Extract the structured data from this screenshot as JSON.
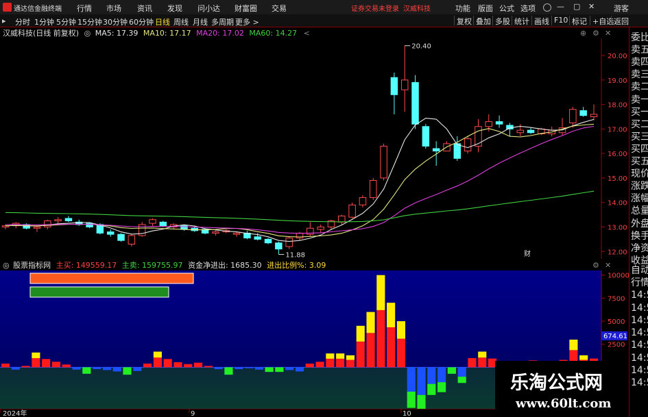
{
  "title_bar": {
    "app_name": "通达信金融终端",
    "menus": [
      "行情",
      "市场",
      "资讯",
      "发现",
      "问小达",
      "财富圈",
      "交易"
    ],
    "warning": "证券交易未登录",
    "stock_name": "汉威科技",
    "right_items": [
      "功能",
      "版面",
      "公式",
      "选项"
    ],
    "guest": "游客"
  },
  "toolbar": {
    "periods": [
      "分时",
      "1分钟",
      "5分钟",
      "15分钟",
      "30分钟",
      "60分钟",
      "日线",
      "周线",
      "月线",
      "多周期",
      "更多 >"
    ],
    "selected": "日线",
    "right_buttons": [
      "复权",
      "叠加",
      "多股",
      "统计",
      "画线",
      "F10",
      "标记",
      "+自选",
      "返回"
    ]
  },
  "main_chart": {
    "stock_label": "汉威科技(日线 前复权)",
    "ma": [
      {
        "label": "MA5: 17.39",
        "color": "#e6e6e6"
      },
      {
        "label": "MA10: 17.17",
        "color": "#e6e680"
      },
      {
        "label": "MA20: 17.02",
        "color": "#e040e0"
      },
      {
        "label": "MA60: 14.27",
        "color": "#40d040"
      }
    ],
    "y_ticks": [
      "20.00",
      "19.00",
      "18.00",
      "17.00",
      "16.00",
      "15.00",
      "14.00",
      "13.00",
      "12.00"
    ],
    "high_label": "20.40",
    "low_label": "11.88",
    "marker_text": "财"
  },
  "indicator": {
    "name": "股票指标网",
    "buy_label": "主买: 149559.17",
    "sell_label": "主卖: 159755.97",
    "net_label": "资金净进出: 1685.30",
    "ratio_label": "进出比例%: 3.09",
    "y_ticks": [
      "10000",
      "7500",
      "5000",
      "2500",
      "0",
      "-2500"
    ],
    "current_value": "674.61"
  },
  "x_axis": {
    "labels": [
      "2024年",
      "9",
      "10"
    ]
  },
  "right_panel": {
    "items": [
      "委比",
      "卖五",
      "卖四",
      "卖三",
      "卖二",
      "卖一",
      "买一",
      "买二",
      "买三",
      "买四",
      "买五",
      "现价",
      "涨跌",
      "涨幅",
      "总量",
      "外盘",
      "换手",
      "净资",
      "收益"
    ],
    "items2": [
      "自动",
      "行情",
      "14:50",
      "14:50",
      "14:50",
      "14:50",
      "14:50",
      "14:50",
      "14:50",
      "14:50"
    ]
  },
  "watermark": {
    "title": "乐淘公式网",
    "url": "www.60lt.com"
  },
  "chart_data": [
    {
      "type": "candlestick",
      "title": "汉威科技(日线 前复权)",
      "y_range": [
        11.7,
        20.7
      ],
      "candles": [
        [
          13,
          13.1,
          12.9,
          13.05
        ],
        [
          13.05,
          13.2,
          12.95,
          13.15
        ],
        [
          13.1,
          13.15,
          12.9,
          12.95
        ],
        [
          12.95,
          13.05,
          12.8,
          13
        ],
        [
          13,
          13.3,
          12.9,
          13.25
        ],
        [
          13.25,
          13.4,
          13.1,
          13.3
        ],
        [
          13.35,
          13.45,
          13.2,
          13.25
        ],
        [
          13.2,
          13.3,
          13.05,
          13.1
        ],
        [
          13.15,
          13.2,
          12.95,
          13
        ],
        [
          13.1,
          13.15,
          12.7,
          12.75
        ],
        [
          12.8,
          12.9,
          12.6,
          12.7
        ],
        [
          12.7,
          12.75,
          12.4,
          12.45
        ],
        [
          12.3,
          12.7,
          12.2,
          12.65
        ],
        [
          12.65,
          13.2,
          12.6,
          13.1
        ],
        [
          13.15,
          13.35,
          13.05,
          13.3
        ],
        [
          13.2,
          13.25,
          13,
          13.05
        ],
        [
          13,
          13.15,
          12.9,
          13.1
        ],
        [
          13.05,
          13.1,
          12.85,
          12.9
        ],
        [
          12.95,
          13.05,
          12.8,
          12.85
        ],
        [
          12.9,
          12.95,
          12.7,
          12.75
        ],
        [
          12.75,
          12.85,
          12.65,
          12.8
        ],
        [
          12.8,
          12.9,
          12.75,
          12.85
        ],
        [
          12.7,
          12.8,
          12.6,
          12.75
        ],
        [
          12.75,
          12.85,
          12.5,
          12.55
        ],
        [
          12.6,
          12.75,
          12.45,
          12.5
        ],
        [
          12.5,
          12.55,
          12.3,
          12.35
        ],
        [
          12.35,
          12.4,
          11.88,
          12.1
        ],
        [
          12.2,
          12.6,
          12.1,
          12.55
        ],
        [
          12.55,
          12.8,
          12.45,
          12.75
        ],
        [
          12.7,
          13.2,
          12.6,
          12.95
        ],
        [
          12.9,
          13.1,
          12.75,
          13
        ],
        [
          13,
          13.3,
          12.9,
          13.25
        ],
        [
          13.2,
          13.5,
          13.1,
          13.45
        ],
        [
          13.4,
          14,
          13.35,
          13.9
        ],
        [
          13.9,
          14.3,
          13.8,
          14.2
        ],
        [
          14.2,
          15,
          14.1,
          14.9
        ],
        [
          15,
          16.4,
          14.9,
          16.3
        ],
        [
          19.1,
          19.3,
          17.6,
          18.4
        ],
        [
          18.6,
          20.4,
          17.7,
          19
        ],
        [
          18.9,
          19.2,
          17,
          17.2
        ],
        [
          17.1,
          17.2,
          16.2,
          16.3
        ],
        [
          16.2,
          16.5,
          15.5,
          16.1
        ],
        [
          16.1,
          16.5,
          16.1,
          16.4
        ],
        [
          16.4,
          16.7,
          15.7,
          15.8
        ],
        [
          16.1,
          16.7,
          16,
          16.6
        ],
        [
          16.3,
          17.4,
          16.05,
          17.1
        ],
        [
          17.1,
          17.6,
          16.9,
          17.3
        ],
        [
          17.3,
          17.55,
          17.05,
          17.2
        ],
        [
          17.15,
          17.25,
          16.7,
          17
        ],
        [
          16.85,
          17.2,
          16.7,
          16.95
        ],
        [
          16.95,
          17.05,
          16.8,
          16.85
        ],
        [
          16.8,
          17.05,
          16.75,
          17
        ],
        [
          16.8,
          17.1,
          16.7,
          16.95
        ],
        [
          16.85,
          17.45,
          16.75,
          17.05
        ],
        [
          17.25,
          17.9,
          17.05,
          17.8
        ],
        [
          17.75,
          17.9,
          17.5,
          17.55
        ],
        [
          17.5,
          18,
          17.35,
          17.6
        ]
      ],
      "series": [
        {
          "name": "MA5",
          "last": 17.39
        },
        {
          "name": "MA10",
          "last": 17.17
        },
        {
          "name": "MA20",
          "last": 17.02
        },
        {
          "name": "MA60",
          "last": 14.27
        }
      ]
    },
    {
      "type": "bar",
      "title": "股票指标网",
      "y_range": [
        -4500,
        10500
      ],
      "values": [
        400,
        -250,
        150,
        1600,
        900,
        600,
        300,
        -250,
        -700,
        -200,
        -300,
        -450,
        -800,
        -400,
        400,
        1700,
        900,
        550,
        350,
        500,
        150,
        -200,
        -800,
        -200,
        -100,
        -250,
        -500,
        -500,
        -300,
        -450,
        400,
        600,
        1500,
        1500,
        1300,
        4500,
        6000,
        10000,
        7000,
        5000,
        -4400,
        -5000,
        -3000,
        -2700,
        -700,
        -1700,
        1000,
        1700,
        950,
        500,
        150,
        300,
        750,
        300,
        300,
        800,
        3000,
        1300,
        950
      ]
    }
  ]
}
